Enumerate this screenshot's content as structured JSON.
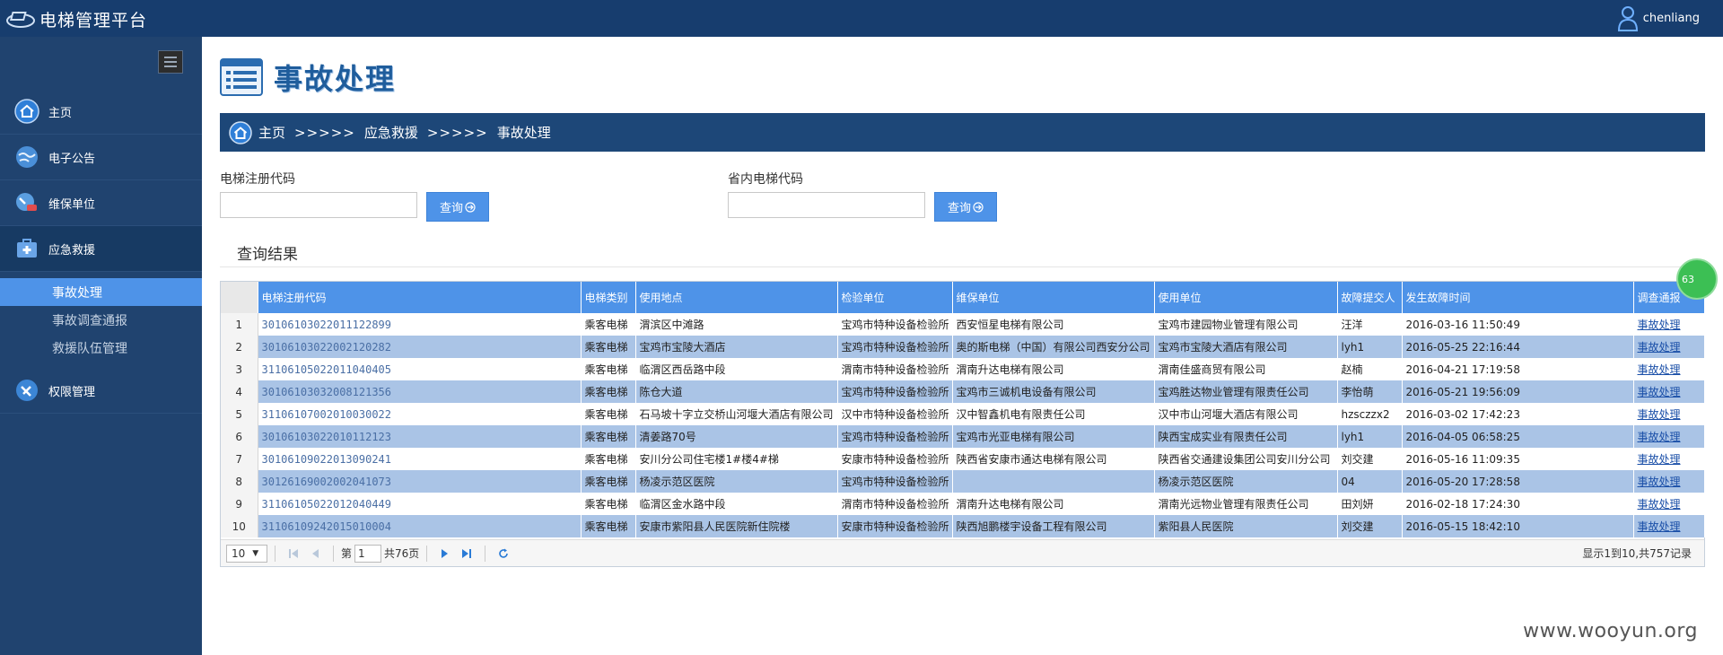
{
  "app": {
    "title": "电梯管理平台",
    "user": "chenliang"
  },
  "sidebar": {
    "items": [
      {
        "label": "主页",
        "icon": "home-icon"
      },
      {
        "label": "电子公告",
        "icon": "globe-icon"
      },
      {
        "label": "维保单位",
        "icon": "wrench-globe-icon"
      },
      {
        "label": "应急救援",
        "icon": "first-aid-icon"
      }
    ],
    "submenu": [
      "事故处理",
      "事故调查通报",
      "救援队伍管理"
    ],
    "bottom_item": {
      "label": "权限管理",
      "icon": "satellite-icon"
    }
  },
  "page": {
    "title": "事故处理",
    "breadcrumb": {
      "home": "主页",
      "sep": ">>>>>",
      "level2": "应急救援",
      "current": "事故处理"
    }
  },
  "search": {
    "field1_label": "电梯注册代码",
    "field1_value": "",
    "field2_label": "省内电梯代码",
    "field2_value": "",
    "button_label": "查询"
  },
  "results": {
    "title": "查询结果",
    "columns": [
      "电梯注册代码",
      "电梯类别",
      "使用地点",
      "检验单位",
      "维保单位",
      "使用单位",
      "故障提交人",
      "发生故障时间",
      "调查通报"
    ],
    "rows": [
      [
        "1",
        "30106103022011122899",
        "乘客电梯",
        "渭滨区中滩路",
        "宝鸡市特种设备检验所",
        "西安恒星电梯有限公司",
        "宝鸡市建园物业管理有限公司",
        "汪洋",
        "2016-03-16 11:50:49",
        "事故处理"
      ],
      [
        "2",
        "30106103022002120282",
        "乘客电梯",
        "宝鸡市宝陵大酒店",
        "宝鸡市特种设备检验所",
        "奥的斯电梯（中国）有限公司西安分公司",
        "宝鸡市宝陵大酒店有限公司",
        "lyh1",
        "2016-05-25 22:16:44",
        "事故处理"
      ],
      [
        "3",
        "31106105022011040405",
        "乘客电梯",
        "临渭区西岳路中段",
        "渭南市特种设备检验所",
        "渭南升达电梯有限公司",
        "渭南佳盛商贸有限公司",
        "赵楠",
        "2016-04-21 17:19:58",
        "事故处理"
      ],
      [
        "4",
        "30106103032008121356",
        "乘客电梯",
        "陈仓大道",
        "宝鸡市特种设备检验所",
        "宝鸡市三诚机电设备有限公司",
        "宝鸡胜达物业管理有限责任公司",
        "李怡萌",
        "2016-05-21 19:56:09",
        "事故处理"
      ],
      [
        "5",
        "31106107002010030022",
        "乘客电梯",
        "石马坡十字立交桥山河堰大酒店有限公司",
        "汉中市特种设备检验所",
        "汉中智鑫机电有限责任公司",
        "汉中市山河堰大酒店有限公司",
        "hzsczzx2",
        "2016-03-02 17:42:23",
        "事故处理"
      ],
      [
        "6",
        "30106103022010112123",
        "乘客电梯",
        "清姜路70号",
        "宝鸡市特种设备检验所",
        "宝鸡市光亚电梯有限公司",
        "陕西宝成实业有限责任公司",
        "lyh1",
        "2016-04-05 06:58:25",
        "事故处理"
      ],
      [
        "7",
        "30106109022013090241",
        "乘客电梯",
        "安川分公司住宅楼1#楼4#梯",
        "安康市特种设备检验所",
        "陕西省安康市通达电梯有限公司",
        "陕西省交通建设集团公司安川分公司",
        "刘交建",
        "2016-05-16 11:09:35",
        "事故处理"
      ],
      [
        "8",
        "30126169002002041073",
        "乘客电梯",
        "杨凌示范区医院",
        "宝鸡市特种设备检验所",
        "",
        "杨凌示范区医院",
        "04",
        "2016-05-20 17:28:58",
        "事故处理"
      ],
      [
        "9",
        "31106105022012040449",
        "乘客电梯",
        "临渭区金水路中段",
        "渭南市特种设备检验所",
        "渭南升达电梯有限公司",
        "渭南光远物业管理有限责任公司",
        "田刘妍",
        "2016-02-18 17:24:30",
        "事故处理"
      ],
      [
        "10",
        "31106109242015010004",
        "乘客电梯",
        "安康市紫阳县人民医院新住院楼",
        "安康市特种设备检验所",
        "陕西旭鹏楼宇设备工程有限公司",
        "紫阳县人民医院",
        "刘交建",
        "2016-05-15 18:42:10",
        "事故处理"
      ]
    ]
  },
  "pager": {
    "page_size": "10",
    "page_prefix": "第",
    "page_value": "1",
    "page_suffix": "共76页",
    "info": "显示1到10,共757记录"
  },
  "badge": "63",
  "watermark": "www.wooyun.org",
  "colors": {
    "topbar": "#173d6e",
    "sidebar": "#20436f",
    "accent": "#4e93e8",
    "row_alt": "#aac4e6"
  }
}
